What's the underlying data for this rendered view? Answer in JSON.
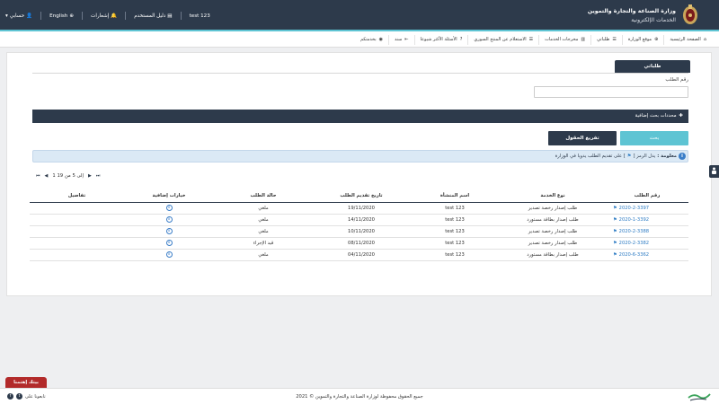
{
  "header": {
    "title": "وزارة الصناعة والتجارة والتموين",
    "subtitle": "الخدمات الإلكترونية",
    "user_name": "test 123",
    "user_guide": "دليل المستخدم",
    "notifications": "إشعارات",
    "language": "English",
    "account": "حسابي"
  },
  "main_nav": {
    "items": [
      {
        "label": "الصفحة الرئيسية",
        "icon": "home-icon"
      },
      {
        "label": "موقع الوزارة",
        "icon": "globe-icon"
      },
      {
        "label": "طلباتي",
        "icon": "list-icon"
      },
      {
        "label": "مخرجات الخدمات",
        "icon": "chart-icon"
      },
      {
        "label": "الاستعلام عن المنتج السوري",
        "icon": "list-icon"
      },
      {
        "label": "الأسئلة الأكثر شيوعا",
        "icon": "question-icon"
      },
      {
        "label": "سند",
        "icon": "sanad-icon"
      },
      {
        "label": "بخدمتكم",
        "icon": "support-icon"
      }
    ]
  },
  "panel": {
    "tab_label": "طلباتي",
    "request_number_label": "رقم الطلب",
    "request_number_value": "",
    "advanced_label": "محددات بحث إضافية",
    "search_button": "بحث",
    "clear_button": "تفريغ الحقول",
    "info_bold": "معلومة :",
    "info_text": "يدل الرمز [",
    "info_text2": "] على تقديم الطلب يدويا في الوزارة",
    "pager_text": "1 إلى 5 من 19"
  },
  "table": {
    "headers": [
      "رقم الطلب",
      "نوع الخدمة",
      "اسم المنشأة",
      "تاريخ تقديم الطلب",
      "حالة الطلب",
      "خيارات إضافية",
      "تفاصيل"
    ],
    "rows": [
      {
        "request": "2020-2-3397",
        "service": "طلب إصدار رخصة تصدير",
        "company": "test 123",
        "date": "19/11/2020",
        "status": "ملغي"
      },
      {
        "request": "2020-1-3392",
        "service": "طلب إصدار بطاقة مستورد",
        "company": "test 123",
        "date": "14/11/2020",
        "status": "ملغي"
      },
      {
        "request": "2020-2-3388",
        "service": "طلب إصدار رخصة تصدير",
        "company": "test 123",
        "date": "10/11/2020",
        "status": "ملغي"
      },
      {
        "request": "2020-2-3382",
        "service": "طلب إصدار رخصة تصدير",
        "company": "test 123",
        "date": "08/11/2020",
        "status": "قيد الإجراء"
      },
      {
        "request": "2020-6-3362",
        "service": "طلب إصدار بطاقة مستورد",
        "company": "test 123",
        "date": "04/11/2020",
        "status": "ملغي"
      }
    ]
  },
  "footer": {
    "stay_home": "بيتك إهتمنا",
    "follow_us": "تابعونا على",
    "copyright": "جميع الحقوق محفوظة لوزارة الصناعة والتجارة والتموين © 2021"
  },
  "colors": {
    "primary": "#2d3a4b",
    "accent": "#5ec4d3",
    "link": "#2e7cc4",
    "danger": "#b22a2a"
  }
}
